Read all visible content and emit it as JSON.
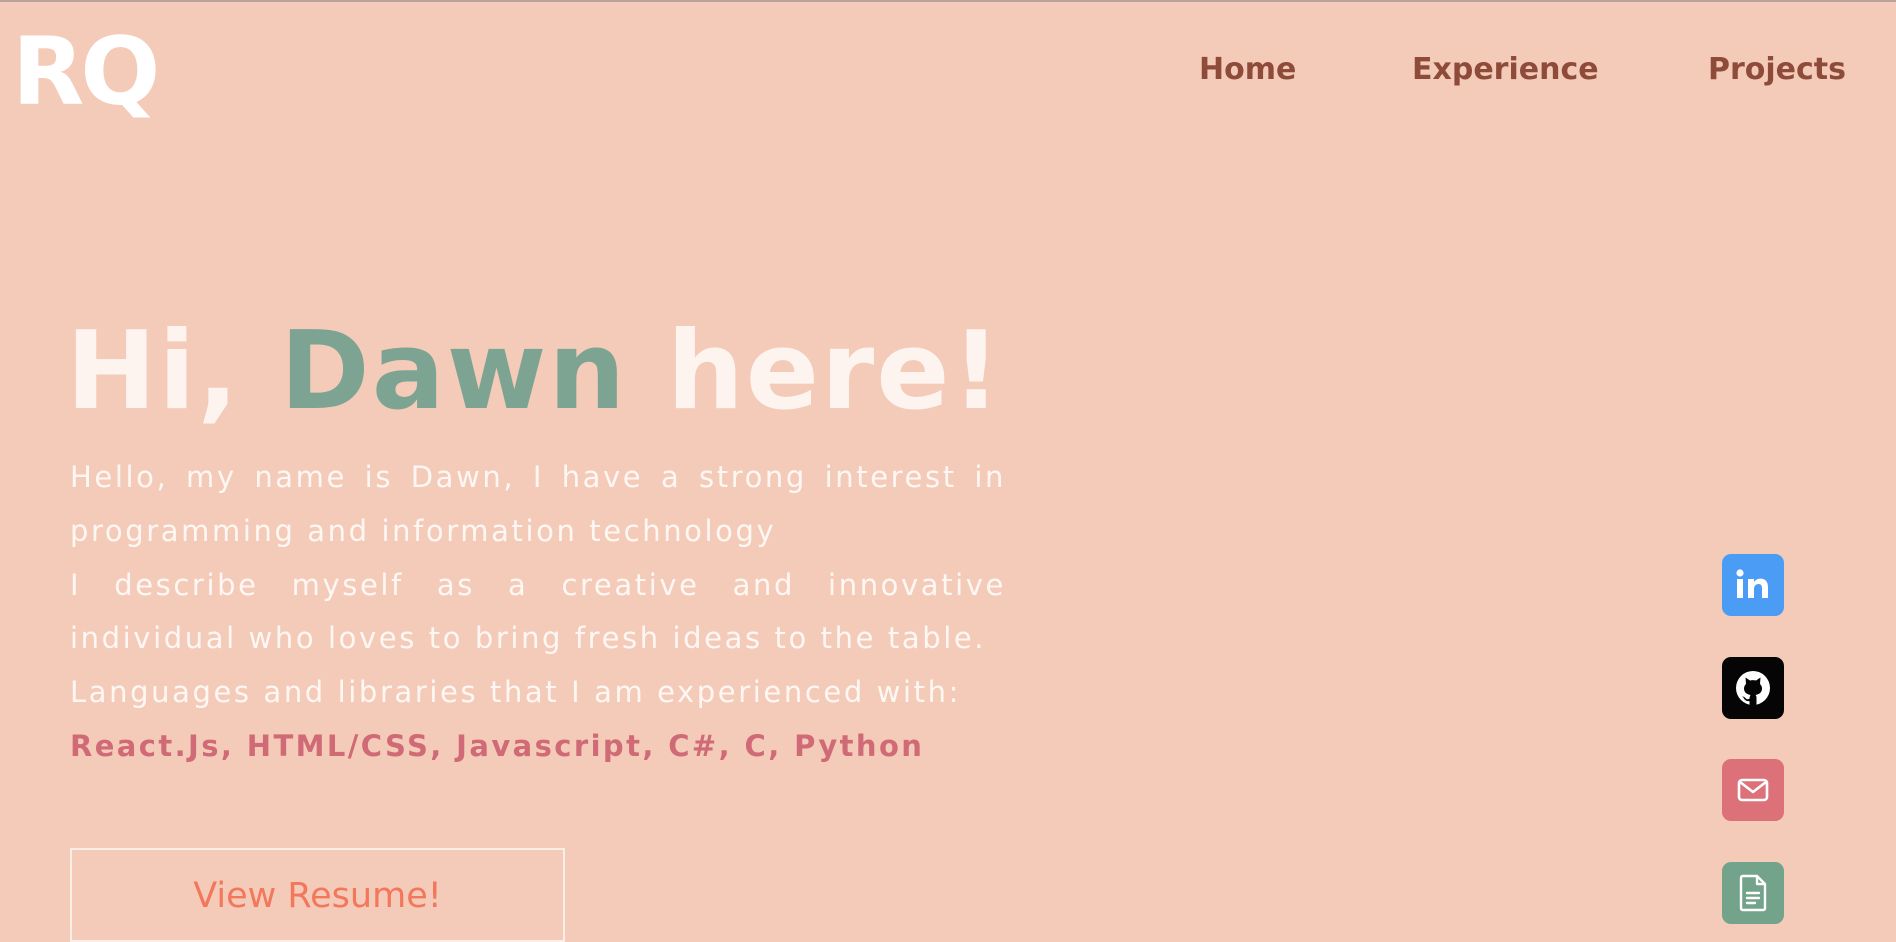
{
  "logo": {
    "text": "RQ"
  },
  "nav": {
    "items": [
      {
        "label": "Home"
      },
      {
        "label": "Experience"
      },
      {
        "label": "Projects"
      }
    ]
  },
  "hero": {
    "greeting_prefix": "Hi, ",
    "name": "Dawn",
    "greeting_suffix": " here!",
    "bio_intro": "Hello, my name is Dawn, I have a strong interest in programming and information technology",
    "bio_describe": "I describe myself as a creative and innovative individual who loves to bring fresh ideas to the table.",
    "languages_label": "Languages and libraries that I am experienced with:",
    "languages": "React.Js, HTML/CSS, Javascript, C#, C, Python",
    "resume_button": "View Resume!"
  },
  "social": [
    {
      "icon": "linkedin-icon",
      "color": "#4b9cf4"
    },
    {
      "icon": "github-icon",
      "color": "#050505"
    },
    {
      "icon": "email-icon",
      "color": "#dc7179"
    },
    {
      "icon": "document-icon",
      "color": "#73a38b"
    }
  ],
  "colors": {
    "background": "#f4cbb9",
    "nav_text": "#8f4b3a",
    "name_accent": "#7da492",
    "languages_accent": "#d06a76",
    "button_text": "#f2775b"
  }
}
